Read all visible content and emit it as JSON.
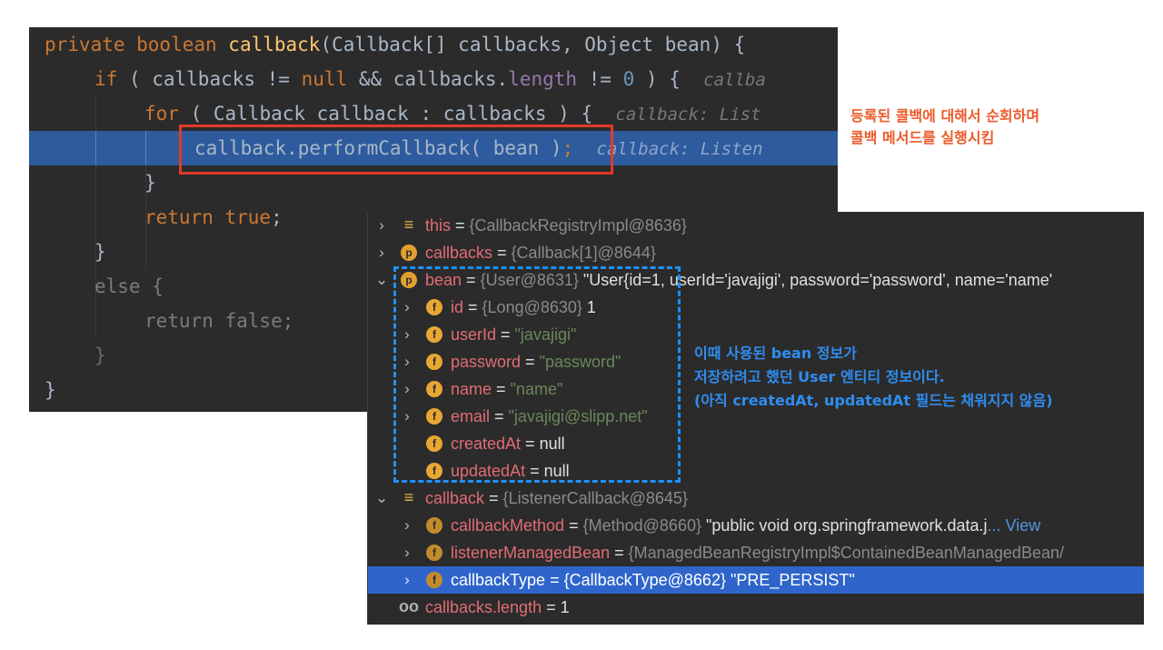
{
  "editor": {
    "line1": {
      "kw": "private boolean ",
      "fn": "callback",
      "rest": "(Callback[] callbacks, Object bean) {"
    },
    "line2": {
      "kw": "if",
      "a": " ( callbacks != ",
      "kw2": "null",
      "b": " && callbacks.",
      "field": "length",
      "c": " != ",
      "num": "0",
      "d": " ) {  ",
      "hint": "callba"
    },
    "line3": {
      "kw": "for",
      "a": " ( Callback callback : callbacks ) {  ",
      "hint": "callback: List"
    },
    "line4": {
      "code": "callback.performCallback( bean )",
      "semi": ";",
      "hint": "callback: Listen"
    },
    "line5": "}",
    "line6": {
      "kw": "return",
      "kw2": " true",
      "rest": ";"
    },
    "line7": "}",
    "line8": "else {",
    "line9": "return false;",
    "line10": "}",
    "line11": "}"
  },
  "debugger": {
    "rows": [
      {
        "name": "this",
        "eq": " = ",
        "meta": "{CallbackRegistryImpl@8636}"
      },
      {
        "name": "callbacks",
        "eq": " = ",
        "meta": "{Callback[1]@8644}"
      },
      {
        "name": "bean",
        "eq": " = ",
        "meta": "{User@8631}",
        "value": " \"User{id=1, userId='javajigi', password='password', name='name'"
      },
      {
        "name": "id",
        "eq": " = ",
        "meta": "{Long@8630}",
        "value": " 1"
      },
      {
        "name": "userId",
        "eq": " = ",
        "str": "\"javajigi\""
      },
      {
        "name": "password",
        "eq": " = ",
        "str": "\"password\""
      },
      {
        "name": "name",
        "eq": " = ",
        "str": "\"name\""
      },
      {
        "name": "email",
        "eq": " = ",
        "str": "\"javajigi@slipp.net\""
      },
      {
        "name": "createdAt",
        "eq": " = ",
        "value": "null"
      },
      {
        "name": "updatedAt",
        "eq": " = ",
        "value": "null"
      },
      {
        "name": "callback",
        "eq": " = ",
        "meta": "{ListenerCallback@8645}"
      },
      {
        "name": "callbackMethod",
        "eq": " = ",
        "meta": "{Method@8660}",
        "value": " \"public void org.springframework.data.j",
        "link": "... View"
      },
      {
        "name": "listenerManagedBean",
        "eq": " = ",
        "meta": "{ManagedBeanRegistryImpl$ContainedBeanManagedBean/"
      },
      {
        "name": "callbackType",
        "eq": " = ",
        "meta": "{CallbackType@8662}",
        "value": " \"PRE_PERSIST\""
      },
      {
        "name": "callbacks.length",
        "eq": " = ",
        "value": "1"
      }
    ],
    "icons": {
      "p": "p",
      "f": "f",
      "list": "≡",
      "watch": "oo",
      "expand": "›",
      "collapse": "⌄"
    }
  },
  "notes": {
    "red": [
      "등록된 콜백에 대해서 순회하며",
      "콜백 메서드를 실행시킴"
    ],
    "blue": [
      "이때 사용된 bean 정보가",
      "저장하려고 했던 User 엔티티 정보이다.",
      "(아직 createdAt, updatedAt 필드는 채워지지 않음)"
    ]
  },
  "colors": {
    "red_note": "#ec5a29",
    "blue_note": "#2f8df0",
    "selection": "#2f65ca",
    "editor_bg": "#2b2b2b"
  }
}
